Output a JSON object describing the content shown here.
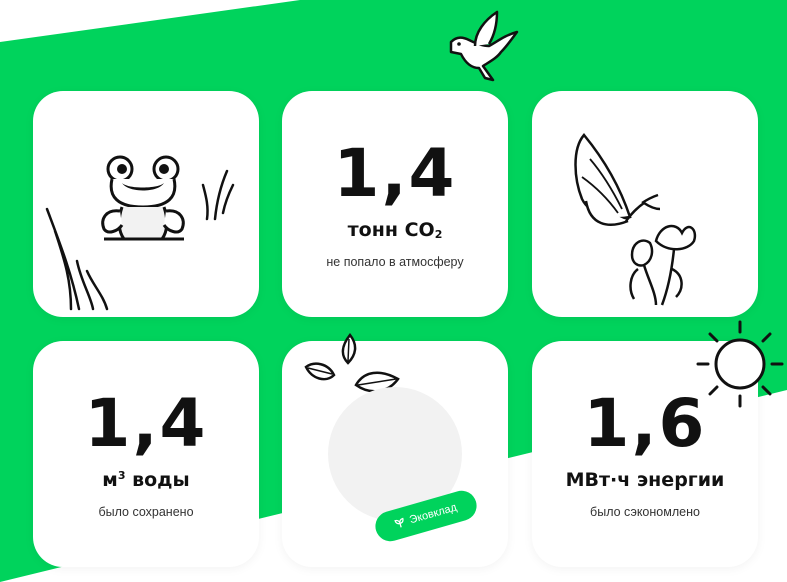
{
  "colors": {
    "accent": "#00d35c",
    "card": "#ffffff",
    "text": "#111111"
  },
  "cards": [
    {
      "id": "frog",
      "icon": "frog-icon"
    },
    {
      "id": "co2",
      "value": "1,4",
      "unit": "тонн CO",
      "unit_sub": "2",
      "caption": "не попало в атмосферу"
    },
    {
      "id": "butterfly",
      "icon": "butterfly-icon"
    },
    {
      "id": "water",
      "value": "1,4",
      "unit_prefix": "м",
      "unit_sup": "3",
      "unit": " воды",
      "caption": "было сохранено"
    },
    {
      "id": "ecodeposit",
      "icon": "leaves-icon",
      "badge": "Эковклад"
    },
    {
      "id": "energy",
      "value": "1,6",
      "unit": "МВт·ч энергии",
      "caption": "было сэкономлено"
    }
  ],
  "decor": [
    "bird-icon",
    "droplets-icon",
    "sun-icon"
  ]
}
